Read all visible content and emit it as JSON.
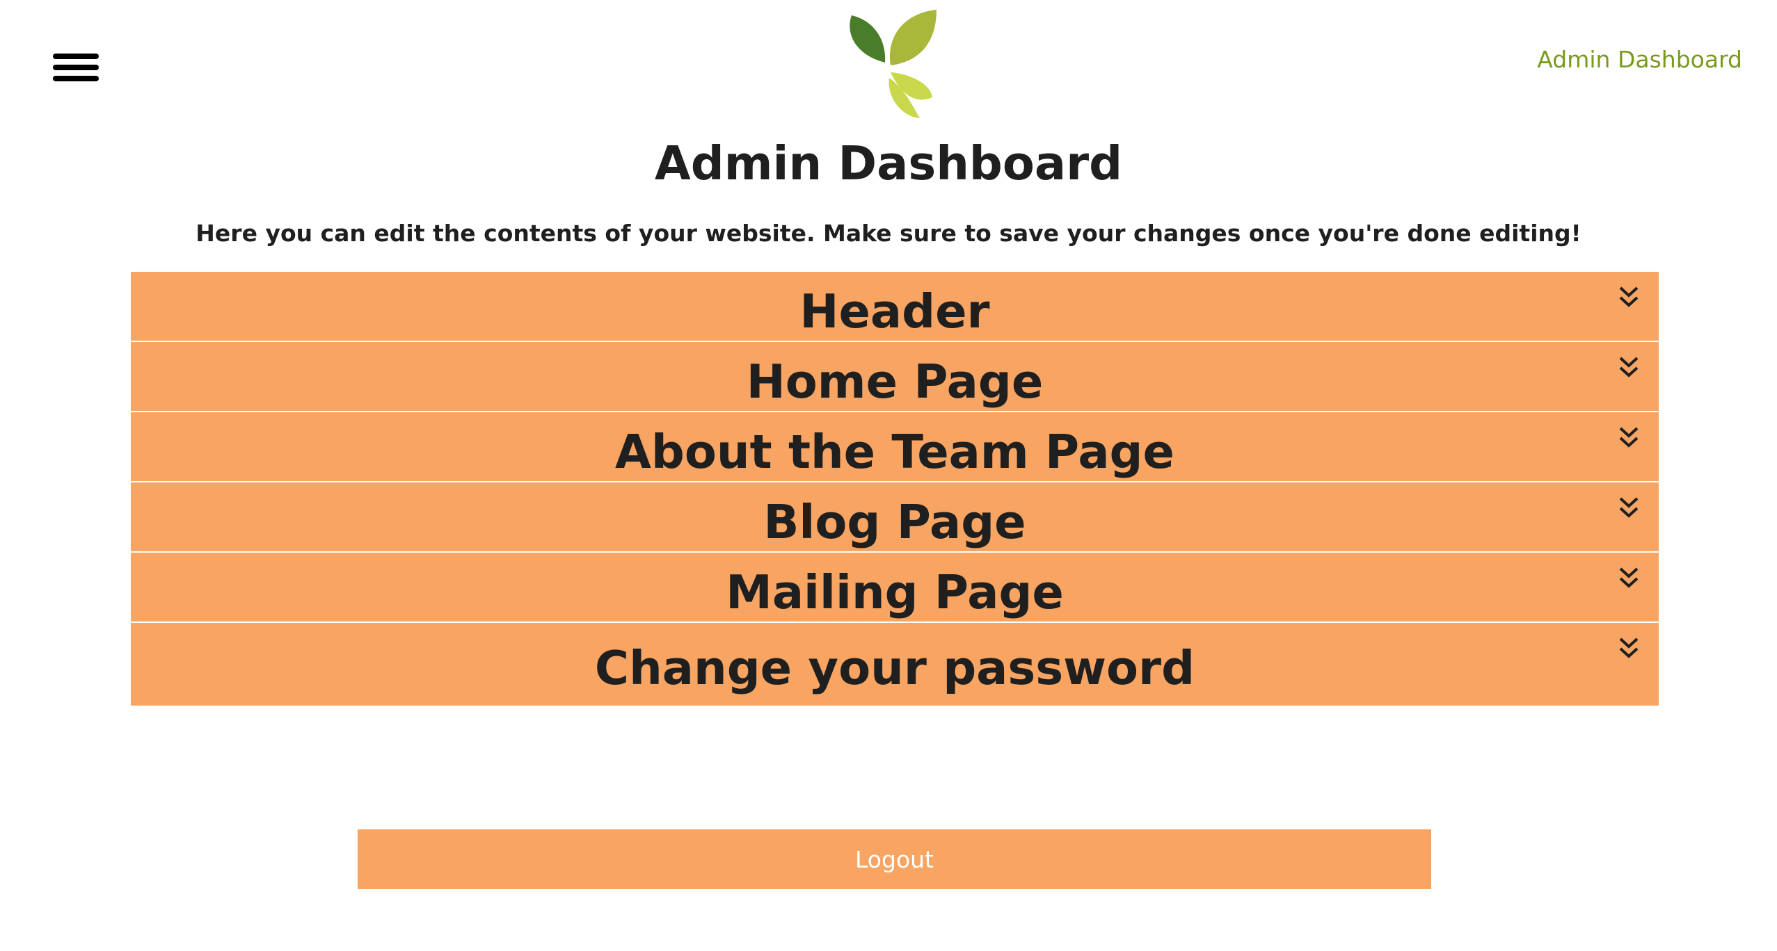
{
  "nav": {
    "menu_icon": "hamburger-icon",
    "logo_icon": "leaf-logo-icon",
    "top_link": "Admin Dashboard"
  },
  "main": {
    "title": "Admin Dashboard",
    "intro": "Here you can edit the contents of your website. Make sure to save your changes once you're done editing!"
  },
  "sections": [
    {
      "label": "Header",
      "icon": "double-chevron-down-icon"
    },
    {
      "label": "Home Page",
      "icon": "double-chevron-down-icon"
    },
    {
      "label": "About the Team Page",
      "icon": "double-chevron-down-icon"
    },
    {
      "label": "Blog Page",
      "icon": "double-chevron-down-icon"
    },
    {
      "label": "Mailing Page",
      "icon": "double-chevron-down-icon"
    },
    {
      "label": "Change your password",
      "icon": "double-chevron-down-icon"
    }
  ],
  "logout": {
    "label": "Logout"
  },
  "colors": {
    "accent": "#f8a564",
    "link": "#7a9a1e",
    "leaf_dark": "#4a7d2a",
    "leaf_mid": "#a9b73a",
    "leaf_light": "#c9d84a"
  }
}
